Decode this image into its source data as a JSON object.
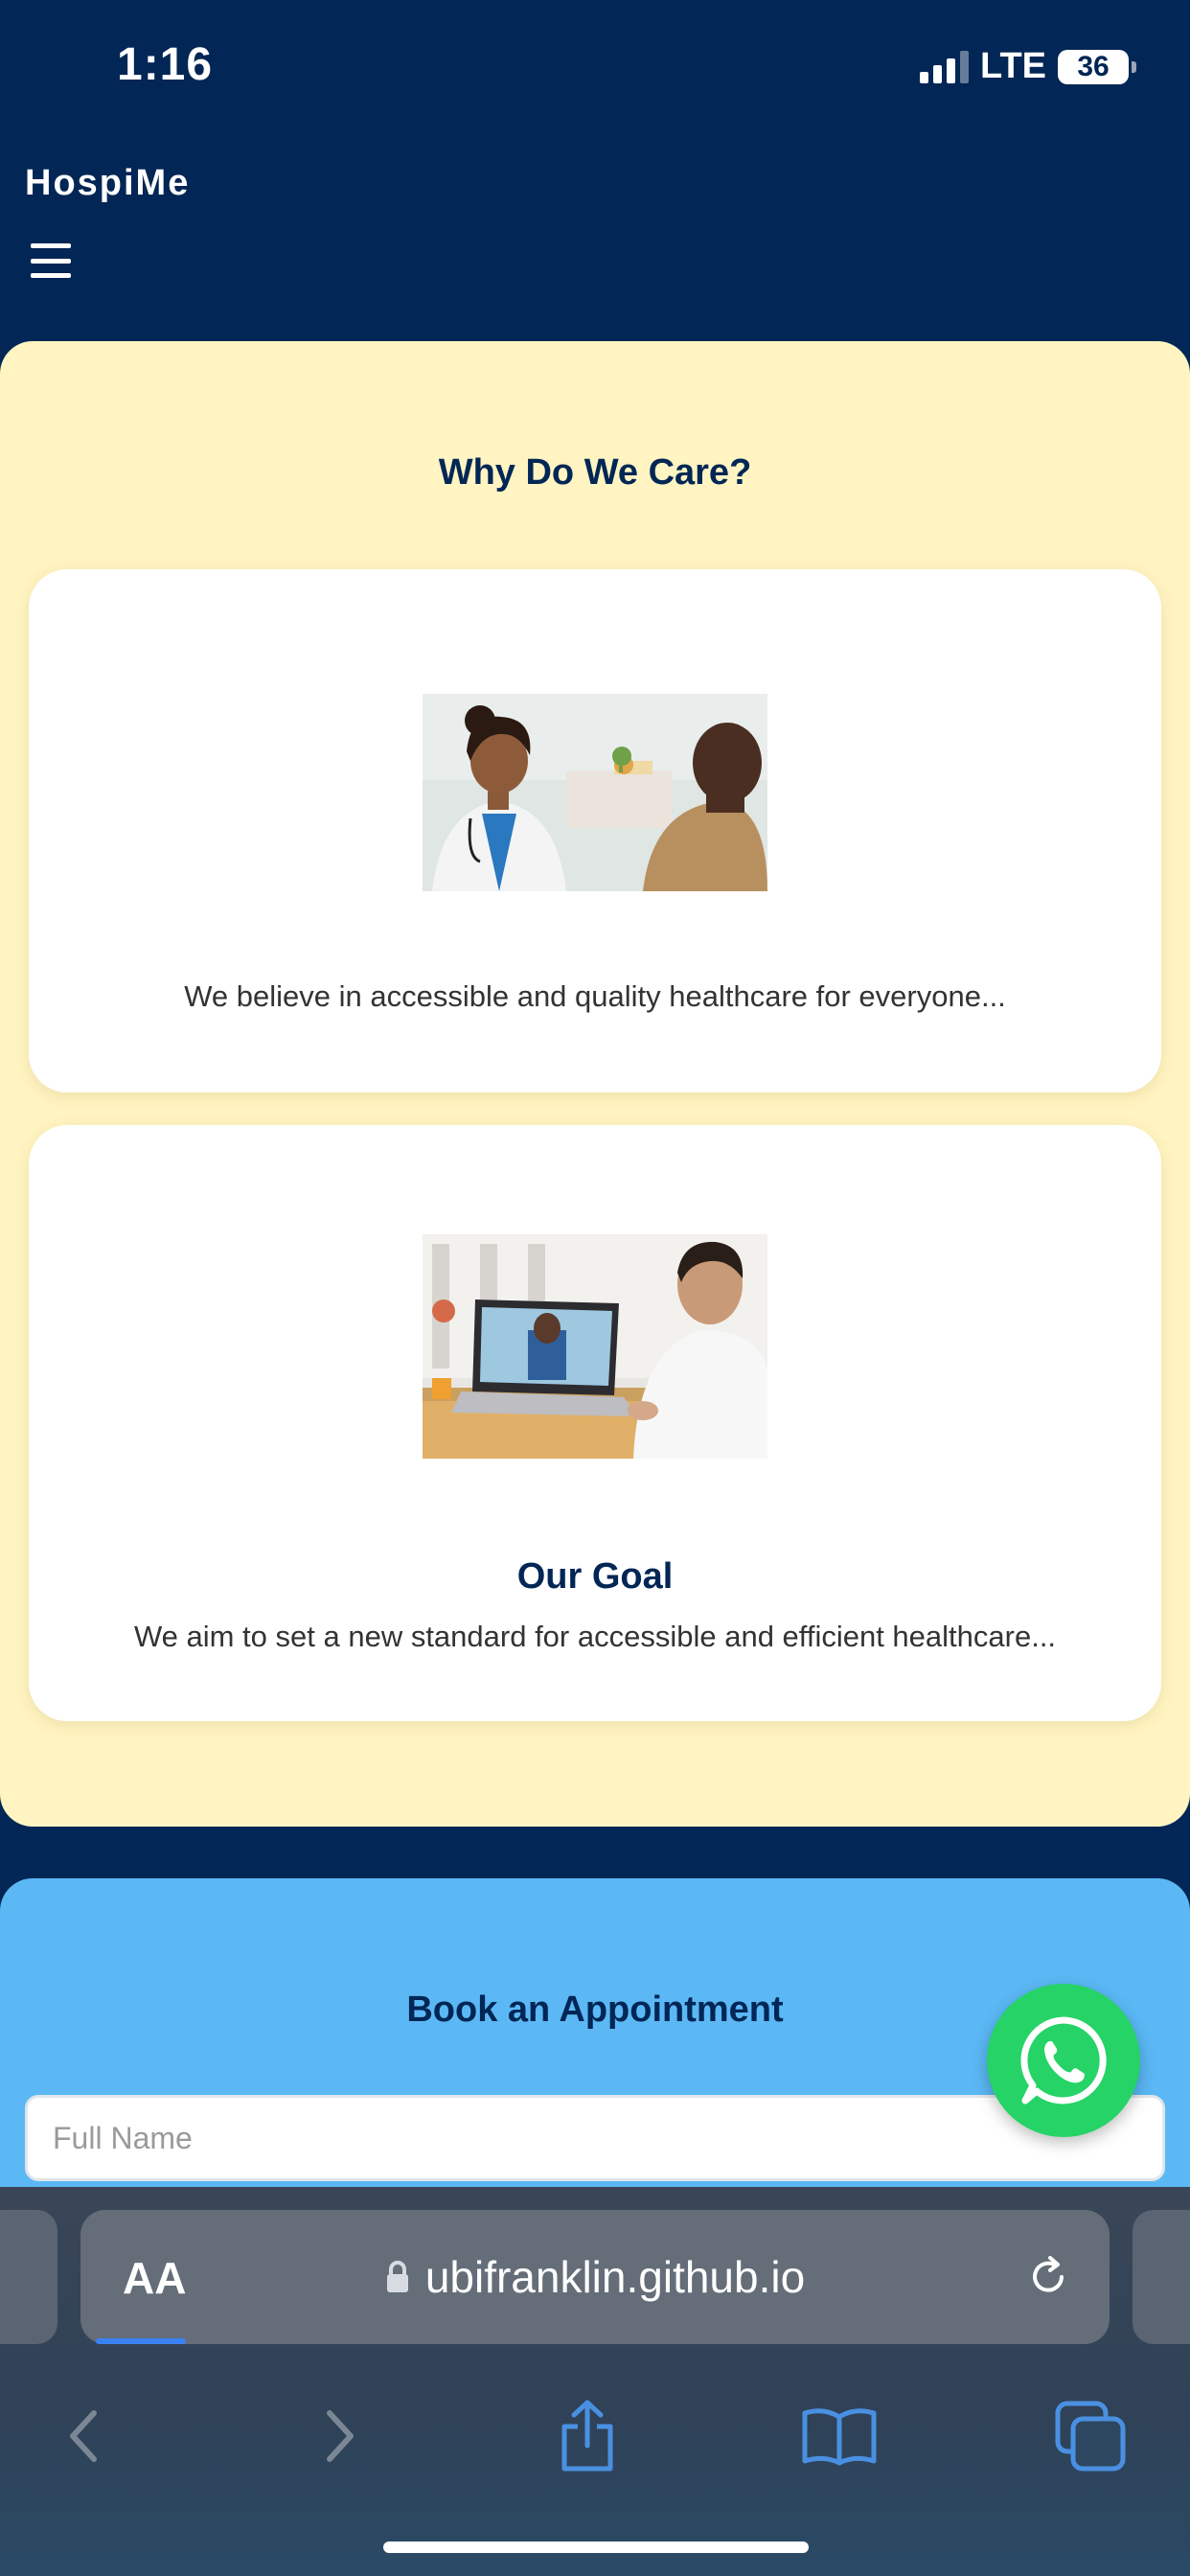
{
  "status_bar": {
    "time": "1:16",
    "network": "LTE",
    "battery": "36"
  },
  "header": {
    "brand": "HospiMe"
  },
  "care_section": {
    "title": "Why Do We Care?",
    "cards": [
      {
        "image_icon": "doctor-consultation-photo",
        "heading": "",
        "text": "We believe in accessible and quality healthcare for everyone..."
      },
      {
        "image_icon": "telemedicine-video-call-photo",
        "heading": "Our Goal",
        "text": "We aim to set a new standard for accessible and efficient healthcare..."
      }
    ]
  },
  "appointment_section": {
    "title": "Book an Appointment",
    "full_name_placeholder": "Full Name"
  },
  "browser": {
    "text_size_label": "AA",
    "url": "ubifranklin.github.io"
  },
  "colors": {
    "header_bg": "#022655",
    "care_bg": "#fff4c2",
    "appointment_bg": "#5bb8f5",
    "whatsapp": "#25d366",
    "accent_blue": "#3b82f6"
  }
}
